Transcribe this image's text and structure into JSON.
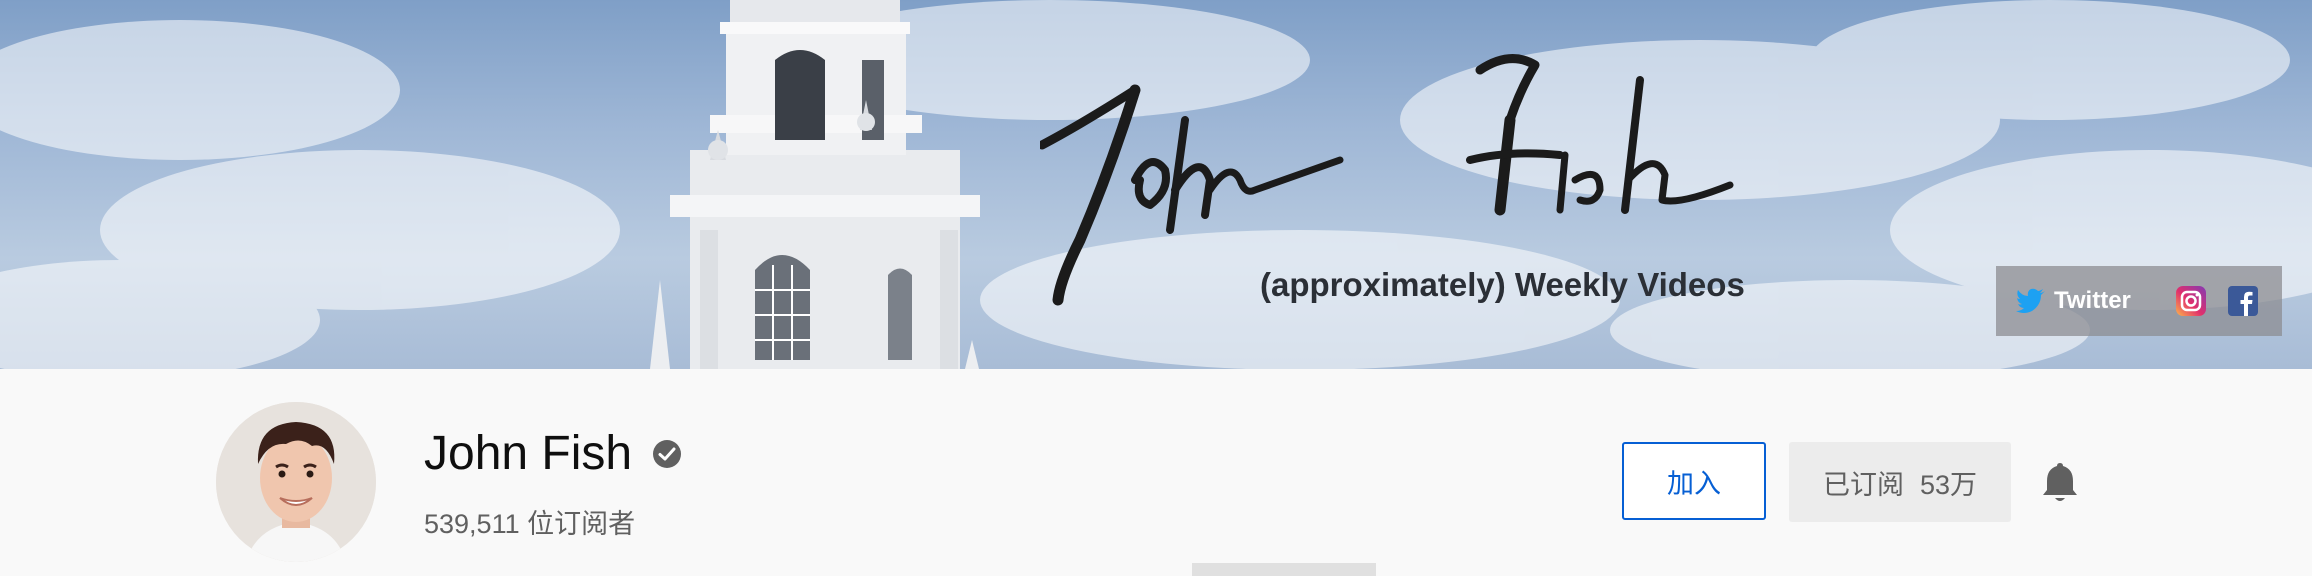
{
  "banner": {
    "signature_text": "John Fish",
    "tagline": "(approximately) Weekly Videos",
    "social": {
      "twitter_label": "Twitter",
      "twitter_color": "#1da1f2",
      "instagram_icon": "instagram-icon",
      "facebook_icon": "facebook-icon",
      "facebook_color": "#3b5998"
    }
  },
  "channel": {
    "name": "John Fish",
    "verified": true,
    "subscribers": "539,511 位订阅者"
  },
  "actions": {
    "join_label": "加入",
    "subscribed_label": "已订阅",
    "subscribed_count": "53万",
    "bell_icon": "bell-icon"
  },
  "colors": {
    "accent": "#065fd4",
    "text_primary": "#0f0f0f",
    "text_secondary": "#606060"
  }
}
